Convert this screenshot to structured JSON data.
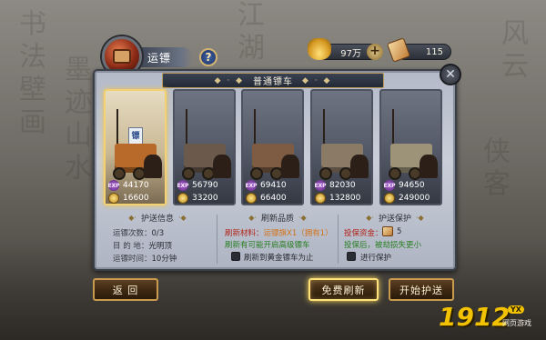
{
  "header": {
    "title": "运镖",
    "help_label": "?",
    "gold": "97万",
    "token": "115",
    "add_label": "+"
  },
  "panel": {
    "heading": "普通镖车",
    "close_label": "✕"
  },
  "carts": [
    {
      "exp": "44170",
      "coins": "16600",
      "body_color": "#b86a2a",
      "flag_text": "镖",
      "selected": true
    },
    {
      "exp": "56790",
      "coins": "33200",
      "body_color": "#6b5a4c",
      "selected": false
    },
    {
      "exp": "69410",
      "coins": "66400",
      "body_color": "#7d5c43",
      "selected": false
    },
    {
      "exp": "82030",
      "coins": "132800",
      "body_color": "#8a7a66",
      "selected": false
    },
    {
      "exp": "94650",
      "coins": "249000",
      "body_color": "#9c9378",
      "selected": false
    }
  ],
  "exp_badge": "EXP",
  "escort_info": {
    "title": "护送信息",
    "count_label": "运镖次数：",
    "count_value": "0/3",
    "destination_label": "目  的  地：",
    "destination_value": "光明顶",
    "time_label": "运镖时间：",
    "time_value": "10分钟"
  },
  "refresh_quality": {
    "title": "刷新品质",
    "material_label": "刷新材料：",
    "material_value": "运镖旗X1（拥有1）",
    "hint": "刷新有可能开启高级镖车",
    "checkbox_label": "刷新到黄金镖车为止"
  },
  "escort_protect": {
    "title": "护送保护",
    "cost_label": "投保资金：",
    "cost_value": "5",
    "hint": "投保后，被劫损失更小",
    "checkbox_label": "进行保护"
  },
  "buttons": {
    "back": "返  回",
    "free_refresh": "免费刷新",
    "start": "开始护送"
  },
  "watermark": {
    "number": "1912",
    "badge": "YX",
    "sub": "网页游戏"
  }
}
